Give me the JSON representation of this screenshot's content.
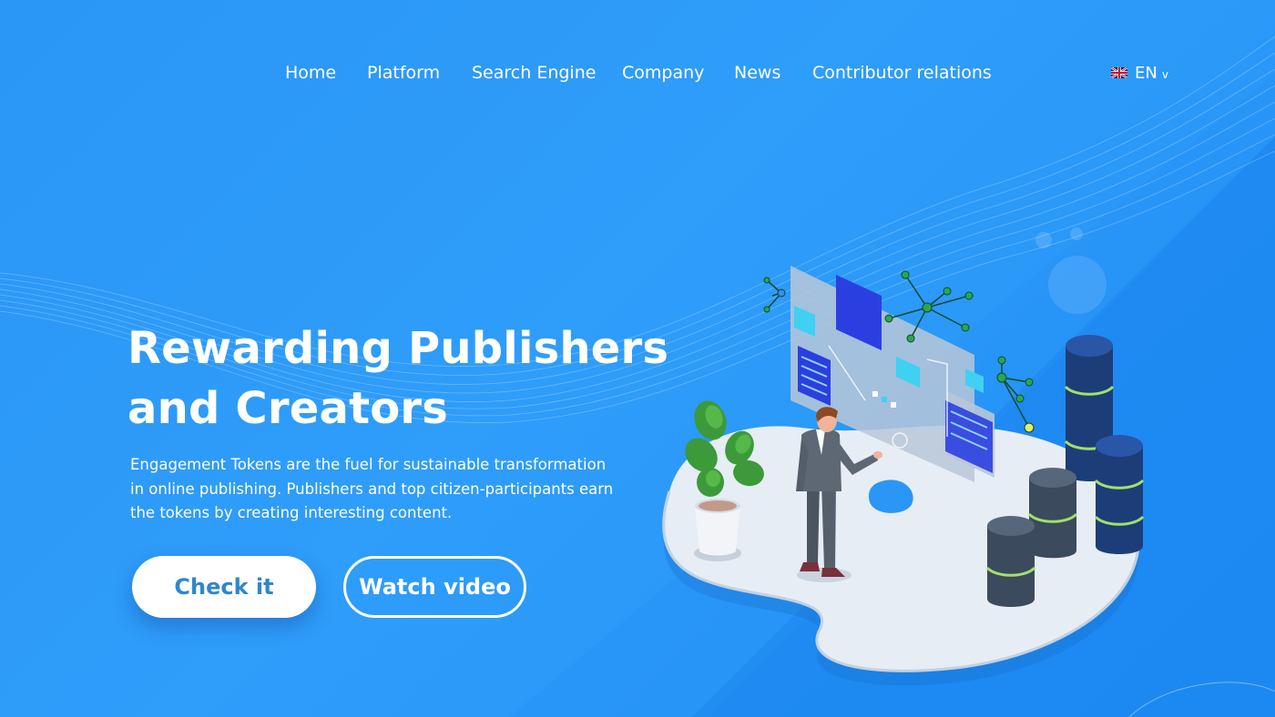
{
  "nav": {
    "items": [
      {
        "label": "Home"
      },
      {
        "label": "Platform"
      },
      {
        "label": "Search Engine"
      },
      {
        "label": "Company"
      },
      {
        "label": "News"
      },
      {
        "label": "Contributor relations"
      }
    ],
    "language": {
      "label": "EN",
      "flag_icon": "uk-flag-icon",
      "chevron_icon": "chevron-down-icon"
    }
  },
  "hero": {
    "title_line1": "Rewarding Publishers",
    "title_line2": "and Creators",
    "description_line1": "Engagement Tokens are the fuel for sustainable transformation",
    "description_line2": "in online publishing. Publishers and top citizen-participants earn",
    "description_line3": "the tokens by creating interesting content.",
    "primary_button": "Check it",
    "secondary_button": "Watch video"
  },
  "colors": {
    "background": "#2a96f6",
    "background_dark": "#1b86f0",
    "button_text": "#2f86cf",
    "platform": "#e6edf5",
    "server_dark": "#1d3d78",
    "server_accent": "#9fe26b"
  },
  "illustration": {
    "subject": "isometric-man-at-holographic-dashboard-icon",
    "plant": "potted-plant-icon",
    "servers": "server-stack-icon",
    "network": "network-node-icon"
  }
}
